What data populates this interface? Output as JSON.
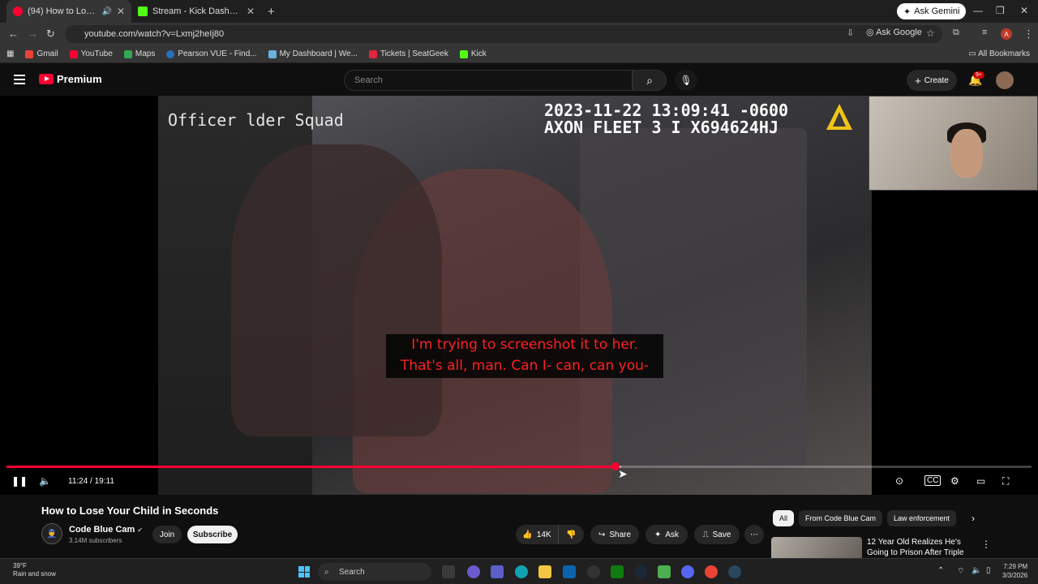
{
  "browser": {
    "tabs": [
      {
        "title": "(94) How to Lose Your Child in Seconds",
        "active": true,
        "color": "#ff0033"
      },
      {
        "title": "Stream - Kick Dashboard",
        "active": false,
        "color": "#53fc18"
      }
    ],
    "ask_gemini": "Ask Gemini",
    "url": "youtube.com/watch?v=Lxmj2heIj80",
    "ask_google": "Ask Google",
    "bookmarks": [
      "Gmail",
      "YouTube",
      "Maps",
      "Pearson VUE - Find...",
      "My Dashboard | We...",
      "Tickets | SeatGeek",
      "Kick"
    ],
    "all_bookmarks": "All Bookmarks",
    "profile_initial": "A"
  },
  "youtube": {
    "logo_label": "Premium",
    "search_placeholder": "Search",
    "create_label": "Create",
    "notif_count": "9+"
  },
  "video": {
    "overlay_officer": "Officer  lder Squad",
    "timestamp_line1": "2023-11-22 13:09:41 -0600",
    "timestamp_line2": "AXON FLEET 3 I X694624HJ",
    "caption_line1": "I'm trying to screenshot it to her.",
    "caption_line2": "That's all, man. Can I- can, can you-",
    "time_display": "11:24 / 19:11",
    "progress_played_fraction": 0.594,
    "progress_buffered_fraction": 0.6,
    "accent": "#ff0033"
  },
  "details": {
    "title": "How to Lose Your Child in Seconds",
    "channel_name": "Code Blue Cam",
    "subscribers": "3.14M subscribers",
    "join": "Join",
    "subscribe": "Subscribe",
    "likes": "14K",
    "share": "Share",
    "ask": "Ask",
    "save": "Save"
  },
  "sidebar": {
    "chips": [
      "All",
      "From Code Blue Cam",
      "Law enforcement"
    ],
    "rec_title": "12 Year Old Realizes He's Going to Prison After Triple Murder"
  },
  "taskbar": {
    "temp": "39°F",
    "weather": "Rain and snow",
    "search": "Search",
    "time": "7:29 PM",
    "date": "3/3/2026"
  }
}
